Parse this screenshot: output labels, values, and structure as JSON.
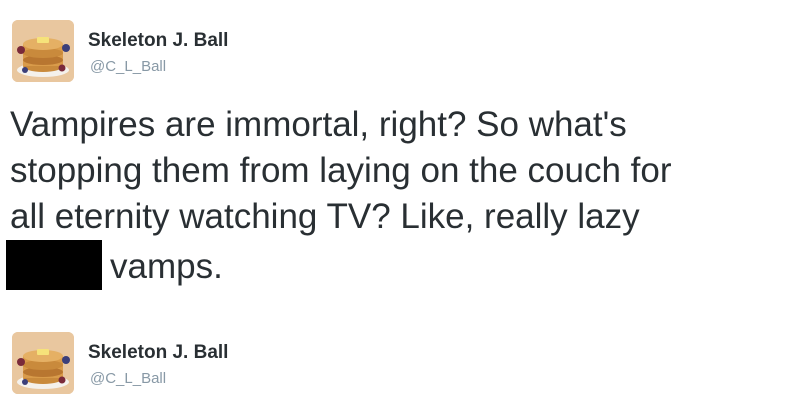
{
  "tweets": [
    {
      "display_name": "Skeleton J. Ball",
      "handle": "@C_L_Ball",
      "text_lines": [
        "Vampires are immortal, right? So what's",
        "stopping them from laying on the couch for",
        "all eternity watching TV? Like, really lazy",
        "vamps."
      ]
    },
    {
      "display_name": "Skeleton J. Ball",
      "handle": "@C_L_Ball"
    }
  ],
  "avatar_icon": "pancake-stack-icon",
  "colors": {
    "name": "#292f33",
    "handle": "#8899a6",
    "redaction": "#000000",
    "avatar_bg": "#e8c49a"
  }
}
